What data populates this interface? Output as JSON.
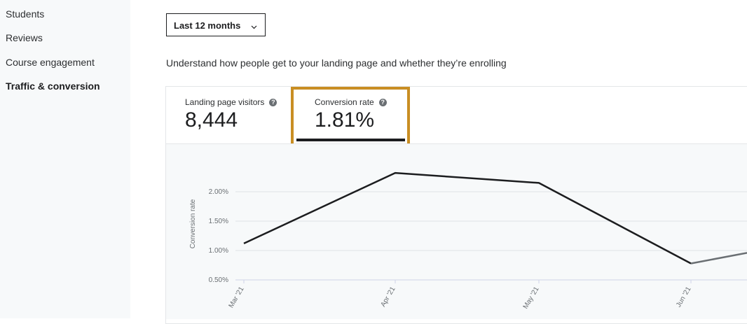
{
  "sidebar": {
    "items": [
      {
        "label": "Students"
      },
      {
        "label": "Reviews"
      },
      {
        "label": "Course engagement"
      },
      {
        "label": "Traffic & conversion",
        "active": true
      }
    ]
  },
  "filter": {
    "selected": "Last 12 months",
    "icon": "chevron-down-icon"
  },
  "description": "Understand how people get to your landing page and whether they’re enrolling",
  "metrics": [
    {
      "label": "Landing page visitors",
      "value": "8,444",
      "icon": "help-icon"
    },
    {
      "label": "Conversion rate",
      "value": "1.81%",
      "icon": "help-icon",
      "selected": true
    }
  ],
  "colors": {
    "accent_highlight": "#c98e23",
    "line": "#1c1d1f",
    "line_partial": "#6a6f73",
    "chart_bg": "#f7f9fa"
  },
  "chart_data": {
    "type": "line",
    "ylabel": "Conversion rate",
    "y_ticks": [
      "0.50%",
      "1.00%",
      "1.50%",
      "2.00%"
    ],
    "ylim": [
      0.5,
      2.0
    ],
    "categories": [
      "Mar '21",
      "Apr '21",
      "May '21",
      "Jun '21"
    ],
    "series": [
      {
        "values": [
          1.12,
          2.32,
          2.15,
          0.78,
          0.96
        ]
      }
    ]
  }
}
